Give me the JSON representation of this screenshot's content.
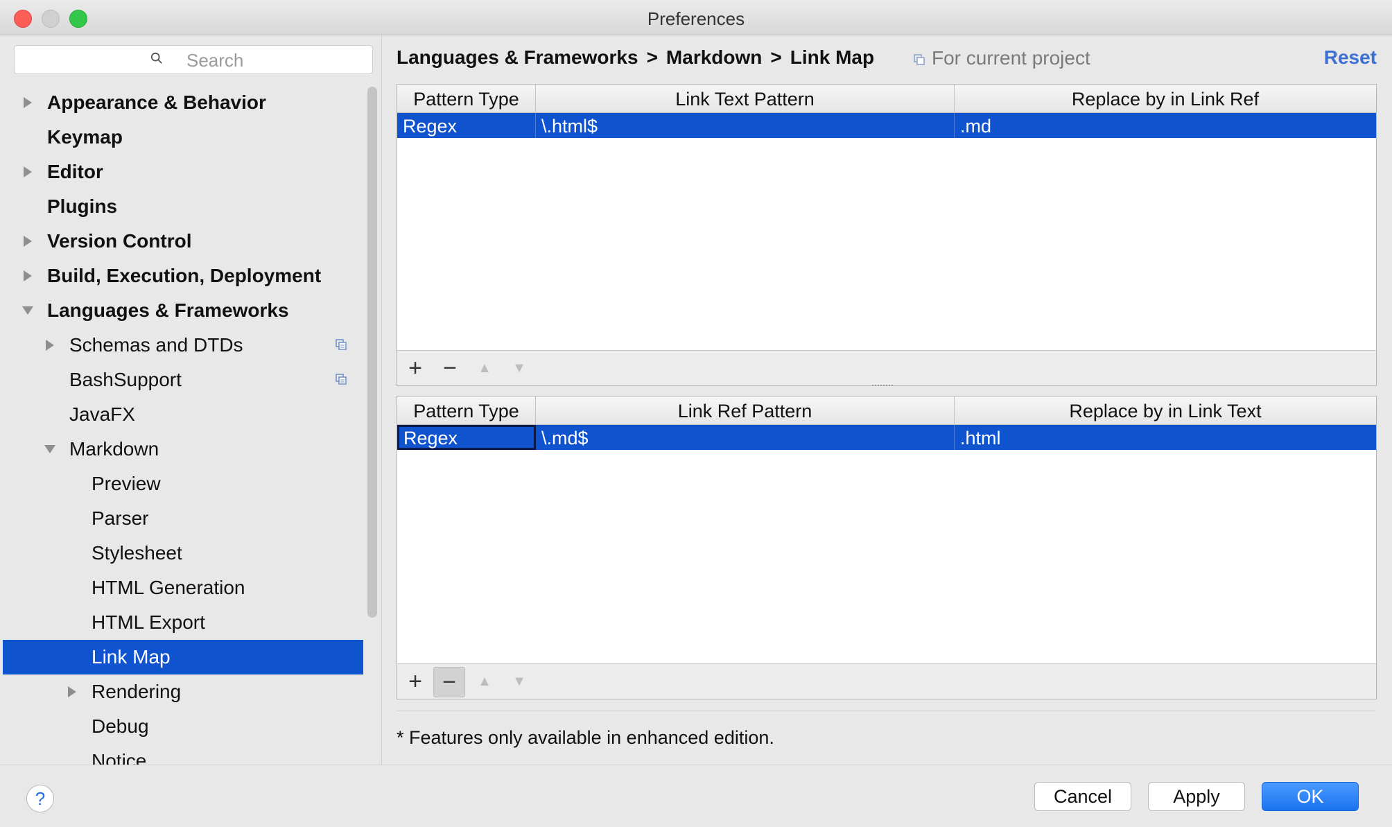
{
  "window": {
    "title": "Preferences"
  },
  "sidebar": {
    "search_placeholder": "Search",
    "items": [
      {
        "label": "Appearance & Behavior"
      },
      {
        "label": "Keymap"
      },
      {
        "label": "Editor"
      },
      {
        "label": "Plugins"
      },
      {
        "label": "Version Control"
      },
      {
        "label": "Build, Execution, Deployment"
      },
      {
        "label": "Languages & Frameworks"
      },
      {
        "label": "Schemas and DTDs"
      },
      {
        "label": "BashSupport"
      },
      {
        "label": "JavaFX"
      },
      {
        "label": "Markdown"
      },
      {
        "label": "Preview"
      },
      {
        "label": "Parser"
      },
      {
        "label": "Stylesheet"
      },
      {
        "label": "HTML Generation"
      },
      {
        "label": "HTML Export"
      },
      {
        "label": "Link Map"
      },
      {
        "label": "Rendering"
      },
      {
        "label": "Debug"
      },
      {
        "label": "Notice"
      }
    ]
  },
  "header": {
    "breadcrumb": [
      "Languages & Frameworks",
      "Markdown",
      "Link Map"
    ],
    "separator": ">",
    "scope": "For current project",
    "reset": "Reset"
  },
  "tables": [
    {
      "columns": [
        "Pattern Type",
        "Link Text Pattern",
        "Replace by in Link Ref"
      ],
      "rows": [
        [
          "Regex",
          "\\.html$",
          ".md"
        ]
      ]
    },
    {
      "columns": [
        "Pattern Type",
        "Link Ref Pattern",
        "Replace by in Link Text"
      ],
      "rows": [
        [
          "Regex",
          "\\.md$",
          ".html"
        ]
      ]
    }
  ],
  "toolbar": {
    "add": "+",
    "remove": "−",
    "up": "▲",
    "down": "▼"
  },
  "note": "* Features only available in enhanced edition.",
  "footer": {
    "help": "?",
    "cancel": "Cancel",
    "apply": "Apply",
    "ok": "OK"
  }
}
